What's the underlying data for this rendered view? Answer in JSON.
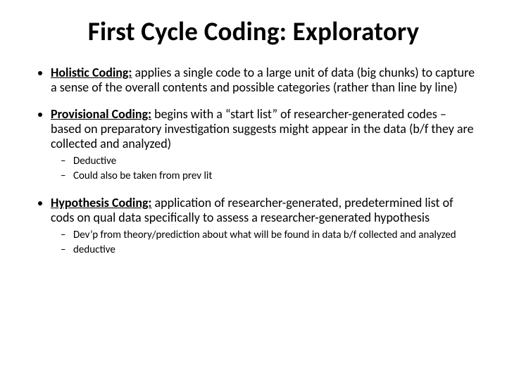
{
  "title": "First Cycle Coding: Exploratory",
  "items": [
    {
      "lead": "Holistic Coding:",
      "body": " applies a single code to a large unit of data (big chunks) to capture a sense of the overall contents and possible categories (rather than line by line)",
      "subs": []
    },
    {
      "lead": "Provisional Coding:",
      "body": " begins with a “start list” of researcher-generated codes – based on preparatory investigation suggests might appear in the data (b/f they are collected and analyzed)",
      "subs": [
        "Deductive",
        "Could also be taken from prev lit"
      ]
    },
    {
      "lead": "Hypothesis Coding:",
      "body": " application of researcher-generated, predetermined list of cods on qual data specifically to assess a researcher-generated hypothesis",
      "subs": [
        "Dev’p from theory/prediction about what will be found in data b/f collected and analyzed",
        "deductive"
      ]
    }
  ]
}
